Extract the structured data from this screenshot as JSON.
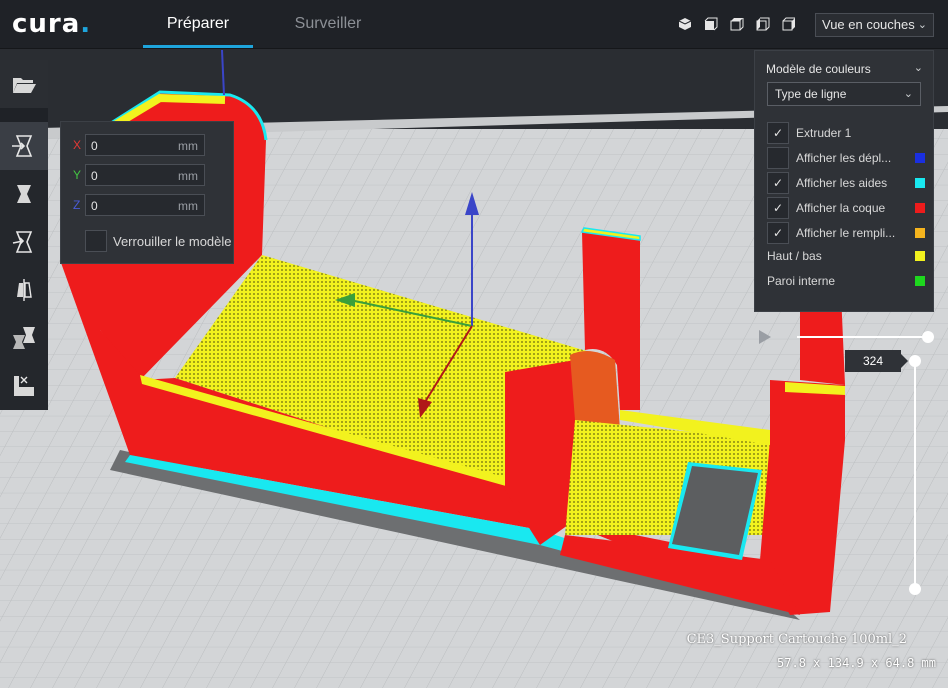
{
  "header": {
    "logo_text": "cura",
    "tabs": [
      {
        "label": "Préparer",
        "active": true
      },
      {
        "label": "Surveiller",
        "active": false
      }
    ],
    "view_icons": [
      "view-3d-icon",
      "view-front-icon",
      "view-top-icon",
      "view-left-icon",
      "view-right-icon"
    ],
    "view_select": "Vue en couches"
  },
  "toolbar": {
    "tools": [
      "open-folder-icon",
      "move-tool-icon",
      "scale-tool-icon",
      "rotate-tool-icon",
      "mirror-tool-icon",
      "per-model-settings-icon",
      "support-blocker-icon"
    ],
    "active_tool": "move-tool-icon"
  },
  "move_panel": {
    "axes": [
      {
        "label": "X",
        "value": "0",
        "unit": "mm",
        "color": "#e53935"
      },
      {
        "label": "Y",
        "value": "0",
        "unit": "mm",
        "color": "#43c443"
      },
      {
        "label": "Z",
        "value": "0",
        "unit": "mm",
        "color": "#4a5bd8"
      }
    ],
    "lock_label": "Verrouiller le modèle",
    "lock_checked": false
  },
  "color_panel": {
    "title": "Modèle de couleurs",
    "scheme": "Type de ligne",
    "rows": [
      {
        "label": "Extruder 1",
        "checked": true,
        "checkbox": true,
        "swatch": ""
      },
      {
        "label": "Afficher les dépl...",
        "checked": false,
        "checkbox": true,
        "swatch": "#1a2fe0"
      },
      {
        "label": "Afficher les aides",
        "checked": true,
        "checkbox": true,
        "swatch": "#19e8f0"
      },
      {
        "label": "Afficher la coque",
        "checked": true,
        "checkbox": true,
        "swatch": "#ee1c1c"
      },
      {
        "label": "Afficher le rempli...",
        "checked": true,
        "checkbox": true,
        "swatch": "#f5b41e"
      },
      {
        "label": "Haut / bas",
        "checked": false,
        "checkbox": false,
        "swatch": "#f2f21e"
      },
      {
        "label": "Paroi interne",
        "checked": false,
        "checkbox": false,
        "swatch": "#1ed81e"
      }
    ]
  },
  "layer_slider": {
    "current_layer": "324"
  },
  "object_info": {
    "name": "CE3_Support Cartouche 100ml_2",
    "dimensions": "57.8 x 134.9 x 64.8 mm"
  },
  "colors": {
    "accent": "#1ea5dc",
    "shell": "#ee1c1c",
    "infill": "#f2f21e",
    "helpers": "#19e8f0"
  }
}
